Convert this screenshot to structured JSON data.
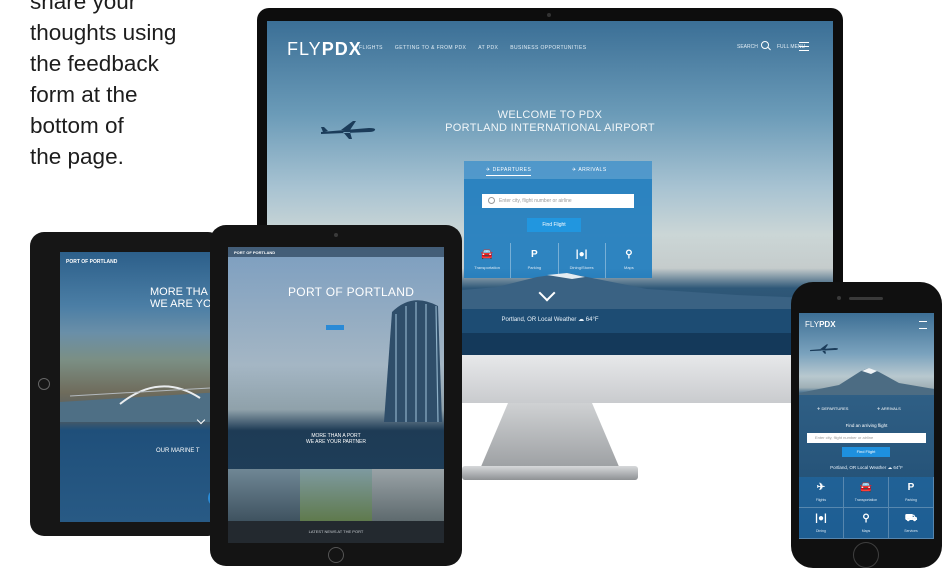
{
  "intro_text": {
    "lines": [
      "share your",
      "thoughts using",
      "the feedback",
      "form at the",
      "bottom of",
      "the page."
    ]
  },
  "desktop": {
    "logo_light": "FLY",
    "logo_bold": "PDX",
    "nav": [
      "FLIGHTS",
      "GETTING TO & FROM PDX",
      "AT PDX",
      "BUSINESS OPPORTUNITIES"
    ],
    "search_label": "SEARCH",
    "menu_label": "FULL MENU",
    "welcome_line1": "WELCOME TO PDX",
    "welcome_line2": "PORTLAND INTERNATIONAL AIRPORT",
    "tab_departures": "DEPARTURES",
    "tab_arrivals": "ARRIVALS",
    "search_placeholder": "Enter city, flight number or airline",
    "find_flight": "Find Flight",
    "quick_links": [
      "Transportation",
      "Parking",
      "Dining/Stores",
      "Maps"
    ],
    "weather": "Portland, OR Local Weather",
    "temperature": "64°F"
  },
  "ipad_landscape": {
    "logo": "PORT OF PORTLAND",
    "headline_1": "MORE THA",
    "headline_2": "WE ARE YOUR",
    "subheading": "OUR MARINE T"
  },
  "ipad_portrait": {
    "logo": "PORT OF PORTLAND",
    "title": "PORT OF PORTLAND",
    "sub_1": "MORE THAN A PORT",
    "sub_2": "WE ARE YOUR PARTNER",
    "footer": "LATEST NEWS AT THE PORT"
  },
  "phone": {
    "logo_light": "FLY",
    "logo_bold": "PDX",
    "tab_departures": "DEPARTURES",
    "tab_arrivals": "ARRIVALS",
    "find_label": "Find an arriving flight",
    "search_placeholder": "Enter city, flight number or airline",
    "find_button": "Find Flight",
    "weather": "Portland, OR Local Weather",
    "temperature": "64°F",
    "tiles": [
      "Flights",
      "Transportation",
      "Parking",
      "Dining",
      "Maps",
      "Services"
    ]
  }
}
